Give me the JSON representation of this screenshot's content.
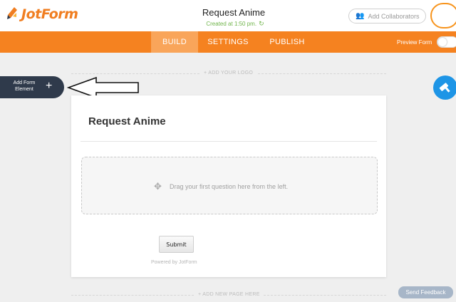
{
  "app": {
    "logo_text": "JotForm"
  },
  "header": {
    "form_title": "Request Anime",
    "created_text": "Created at 1:50 pm.",
    "collaborators_label": "Add Collaborators"
  },
  "nav": {
    "tabs": [
      {
        "label": "BUILD",
        "active": true
      },
      {
        "label": "SETTINGS",
        "active": false
      },
      {
        "label": "PUBLISH",
        "active": false
      }
    ],
    "preview_label": "Preview Form",
    "preview_enabled": false
  },
  "canvas": {
    "add_logo_label": "+ ADD YOUR LOGO",
    "add_page_label": "+ ADD NEW PAGE HERE",
    "add_element_label": "Add Form Element",
    "add_element_icon": "plus-icon"
  },
  "form": {
    "title": "Request Anime",
    "drop_text": "Drag your first question here from the left.",
    "submit_label": "Submit",
    "powered_by": "Powered by JotForm"
  },
  "feedback_label": "Send Feedback",
  "colors": {
    "brand_orange": "#f58220",
    "active_tab": "#f9a55a",
    "dark_panel": "#2f3a4b",
    "accent_blue": "#1e95e6",
    "created_green": "#6fb44a"
  }
}
